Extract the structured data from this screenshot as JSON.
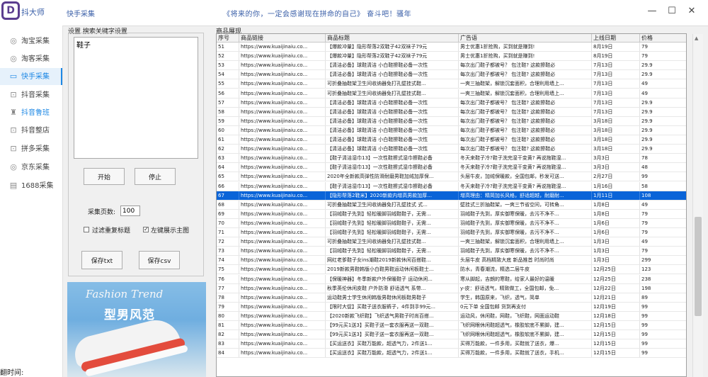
{
  "header": {
    "logo_letter": "D",
    "brand": "抖大师",
    "app_title": "快手采集",
    "slogan": "《将来的你，一定会感谢现在拼命的自己》 奋斗吧！骚年",
    "min_symbol": "—",
    "max_symbol": "☐",
    "close_symbol": "✕"
  },
  "sidebar": {
    "items": [
      {
        "label": "淘宝采集",
        "icon": "shield-icon",
        "glyph": "◎"
      },
      {
        "label": "淘客采集",
        "icon": "coupon-icon",
        "glyph": "◎"
      },
      {
        "label": "快手采集",
        "icon": "card-icon",
        "glyph": "▭"
      },
      {
        "label": "抖音采集",
        "icon": "bag-icon",
        "glyph": "⊡"
      },
      {
        "label": "抖音鲁班",
        "icon": "shirt-icon",
        "glyph": "♜"
      },
      {
        "label": "抖音整店",
        "icon": "store-icon",
        "glyph": "⊡"
      },
      {
        "label": "拼多采集",
        "icon": "cart-icon",
        "glyph": "⊡"
      },
      {
        "label": "京东采集",
        "icon": "shield-icon",
        "glyph": "◎"
      },
      {
        "label": "1688采集",
        "icon": "box-icon",
        "glyph": "▤"
      }
    ],
    "active_index": 2,
    "footer_label": "翻时间:"
  },
  "settings": {
    "legend": "设置 搜索关键字设置",
    "keyword": "鞋子",
    "start_label": "开始",
    "stop_label": "停止",
    "pages_label": "采集页数:",
    "pages_value": "100",
    "filter_dup_label": "过滤重复标题",
    "filter_dup_checked": false,
    "show_main_image_label": "左键展示主图",
    "show_main_image_checked": true,
    "save_txt_label": "保存txt",
    "save_csv_label": "保存csv",
    "check_mark": "✓"
  },
  "banner": {
    "script_text": "Fashion Trend",
    "title": "型男风范"
  },
  "grid": {
    "legend": "商品展现",
    "columns": [
      "序号",
      "商品链接",
      "商品标题",
      "广告语",
      "上线日期",
      "价格"
    ],
    "selected_index": 16,
    "rows": [
      [
        "51",
        "https://www.kuaijinaiu.co...",
        "【爆款冲量】隐形帮落2双鞋子42双袜子79元",
        "男士优惠1折抢购，买到就是赚到!",
        "8月19日",
        "79"
      ],
      [
        "52",
        "https://www.kuaijinaiu.co...",
        "【爆款冲量】隐形帮落2双鞋子42双袜子79元",
        "男士优惠1折抢购，买到就是赚到!",
        "8月19日",
        "79"
      ],
      [
        "53",
        "https://www.kuaijinaiu.co...",
        "【清洁必备】球鞋清洁 小白鞋擦鞋必备一次性",
        "每次出门鞋子都被号？ 包注鞋? 这款擦鞋必",
        "7月13日",
        "29.9"
      ],
      [
        "54",
        "https://www.kuaijinaiu.co...",
        "【清洁必备】球鞋清洁 小白鞋擦鞋必备一次性",
        "每次出门鞋子都被号？ 包注鞋? 这款擦鞋必",
        "7月13日",
        "29.9"
      ],
      [
        "55",
        "https://www.kuaijinaiu.co...",
        "可折叠抽鞋架卫生间收纳器免打孔壁挂式鞋...",
        "一爽三抽鞋架，解锁沉套面积，合理利用墙上...",
        "7月13日",
        "49"
      ],
      [
        "56",
        "https://www.kuaijinaiu.co...",
        "可折叠抽鞋架卫生间收纳器免打孔壁挂式鞋...",
        "一爽三抽鞋架，解锁沉套面积，合理利用墙上...",
        "7月13日",
        "49"
      ],
      [
        "57",
        "https://www.kuaijinaiu.co...",
        "【清洁必备】球鞋清洁 小白鞋擦鞋必备一次性",
        "每次出门鞋子都被号？ 包注鞋? 这款擦鞋必",
        "7月13日",
        "29.9"
      ],
      [
        "58",
        "https://www.kuaijinaiu.co...",
        "【清洁必备】球鞋清洁 小白鞋擦鞋必备一次性",
        "每次出门鞋子都被号？ 包注鞋? 这款擦鞋必",
        "7月13日",
        "29.9"
      ],
      [
        "59",
        "https://www.kuaijinaiu.co...",
        "【清洁必备】球鞋清洁 小白鞋擦鞋必备一次性",
        "每次出门鞋子都被号？ 包注鞋? 这款擦鞋必",
        "3月18日",
        "29.9"
      ],
      [
        "60",
        "https://www.kuaijinaiu.co...",
        "【清洁必备】球鞋清洁 小白鞋擦鞋必备一次性",
        "每次出门鞋子都被号？ 包注鞋? 这款擦鞋必",
        "3月18日",
        "29.9"
      ],
      [
        "61",
        "https://www.kuaijinaiu.co...",
        "【清洁必备】球鞋清洁 小白鞋擦鞋必备一次性",
        "每次出门鞋子都被号？ 包注鞋? 这款擦鞋必",
        "3月18日",
        "29.9"
      ],
      [
        "62",
        "https://www.kuaijinaiu.co...",
        "【清洁必备】球鞋清洁 小白鞋擦鞋必备一次性",
        "每次出门鞋子都被号？ 包注鞋? 这款擦鞋必",
        "3月18日",
        "29.9"
      ],
      [
        "63",
        "https://www.kuaijinaiu.co...",
        "【鞋子清洁湿巾13】一次性鞋擦式湿巾擦鞋必备",
        "冬天来鞋子冷?鞋子洗完湿干变黄? 再说拖鞋湿...",
        "3月3日",
        "78"
      ],
      [
        "64",
        "https://www.kuaijinaiu.co...",
        "【鞋子清洁湿巾13】一次性鞋擦式湿巾擦鞋必备",
        "冬天来鞋子冷?鞋子洗完湿干变黄? 再说拖鞋湿...",
        "3月3日",
        "48"
      ],
      [
        "65",
        "https://www.kuaijinaiu.co...",
        "2020年全新款高弹性防滑耐磨男鞋加绒加厚保...",
        "头层牛皮，加绒保暖款，全国包邮，秒发可送...",
        "2月27日",
        "99"
      ],
      [
        "66",
        "https://www.kuaijinaiu.co...",
        "【鞋子清洁湿巾13】一次性鞋擦式湿巾擦鞋必备",
        "冬天来鞋子冷?鞋子洗完湿干变黄? 再说拖鞋湿...",
        "1月16日",
        "58"
      ],
      [
        "67",
        "https://www.kuaijinaiu.co...",
        "【隐形帮落2鞋米】2020新款内增高男款加厚...",
        "增高理由：精简加长风格，舒适超越，耐磨耐...",
        "1月11日",
        "108"
      ],
      [
        "68",
        "https://www.kuaijinaiu.co...",
        "可折叠抽鞋架卫生间收纳器免打孔壁挂式 式...",
        "壁挂式三折抽鞋架，一爽三节省空间，可转角...",
        "1月8日",
        "49"
      ],
      [
        "69",
        "https://www.kuaijinaiu.co...",
        "【羽绒鞋子先到】轻松暖脚羽绒鞋鞋子，无需...",
        "羽绒鞋子先到，厚实御寒保暖，去污不净不...",
        "1月8日",
        "79"
      ],
      [
        "70",
        "https://www.kuaijinaiu.co...",
        "【羽绒鞋子先到】轻松暖脚羽绒鞋鞋子，无需...",
        "羽绒鞋子先到，厚实御寒保暖，去污不净不...",
        "1月6日",
        "79"
      ],
      [
        "71",
        "https://www.kuaijinaiu.co...",
        "【羽绒鞋子先到】轻松暖脚羽绒鞋鞋子，无需...",
        "羽绒鞋子先到，厚实御寒保暖，去污不净不...",
        "1月6日",
        "79"
      ],
      [
        "72",
        "https://www.kuaijinaiu.co...",
        "可折叠抽鞋架卫生间收纳器免打孔壁挂式鞋...",
        "一爽三抽鞋架，解锁沉套面积，合理利用墙上...",
        "1月3日",
        "49"
      ],
      [
        "73",
        "https://www.kuaijinaiu.co...",
        "【羽绒鞋子先到】轻松暖脚羽绒鞋鞋子，无需...",
        "羽绒鞋子先到，厚实御寒保暖，去污不净不...",
        "1月3日",
        "79"
      ],
      [
        "74",
        "https://www.kuaijinaiu.co...",
        "网红老爹鞋子女ins潮鞋2019新款休闲百搭鞋...",
        "头层牛皮 高档精致大底 新品推首 时尚时尚",
        "1月3日",
        "299"
      ],
      [
        "75",
        "https://www.kuaijinaiu.co...",
        "2019新款男鞋韩版小白鞋男鞋运动休闲板鞋士...",
        "防水，青春潮流，精选二层牛皮",
        "12月25日",
        "123"
      ],
      [
        "76",
        "https://www.kuaijinaiu.co...",
        "【保暖神器】冬季新款户外保暖鞋子 运动休闲...",
        "寒从脚起，吉朗的寒鞋，给家人最好的温暖",
        "12月25日",
        "238"
      ],
      [
        "77",
        "https://www.kuaijinaiu.co...",
        "秋季英伦休闲皮鞋 户外防滑 舒适透气 系带...",
        "y-皮：舒适透气，精致做工，全国包邮，免...",
        "12月22日",
        "198"
      ],
      [
        "78",
        "https://www.kuaijinaiu.co...",
        "运动鞋男士学生休闲韩版男鞋休闲板鞋男鞋子",
        "学生，韩国原来，飞织，透气，简单",
        "12月21日",
        "89"
      ],
      [
        "79",
        "https://www.kuaijinaiu.co...",
        "【限时大促】买鞋子送衣服裤子，4件到手99元...",
        "0元下单 全国包邮 货到再支付",
        "12月19日",
        "99"
      ],
      [
        "80",
        "https://www.kuaijinaiu.co...",
        "【2020新款飞织鞋】飞织透气男鞋子时尚百搭...",
        "运动风，休闲鞋，网鞋，飞织鞋，网面运动鞋",
        "12月18日",
        "99"
      ],
      [
        "81",
        "https://www.kuaijinaiu.co...",
        "【99元买1送3】买鞋子送一套衣服再送一双鞋...",
        "飞织网眼休闲鞋超透气，橡胶软底不累脚，建...",
        "12月15日",
        "99"
      ],
      [
        "82",
        "https://www.kuaijinaiu.co...",
        "【99元买1送3】买鞋子送一套衣服再送一双鞋...",
        "飞织网眼休闲鞋超透气，橡胶软底不累脚，建...",
        "12月15日",
        "99"
      ],
      [
        "83",
        "https://www.kuaijinaiu.co...",
        "【买运送衣】买鞋万能款，超透气力，2件送1...",
        "买得万能款，一件多用，买鞋就了送衣，爆...",
        "12月15日",
        "99"
      ],
      [
        "84",
        "https://www.kuaijinaiu.co...",
        "【买运送衣】买鞋万能款，超透气力，2件送1...",
        "买得万能款，一件多用，买鞋就了送衣，手机...",
        "12月15日",
        "99"
      ]
    ]
  }
}
